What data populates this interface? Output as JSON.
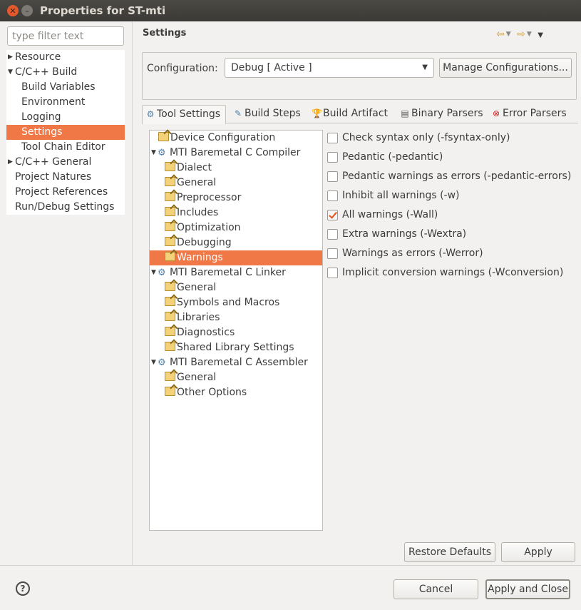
{
  "window": {
    "title": "Properties for ST-mti"
  },
  "filter": {
    "placeholder": "type filter text"
  },
  "nav": {
    "items": [
      {
        "label": "Resource",
        "level": 0,
        "arrow": "right"
      },
      {
        "label": "C/C++ Build",
        "level": 0,
        "arrow": "down"
      },
      {
        "label": "Build Variables",
        "level": 1
      },
      {
        "label": "Environment",
        "level": 1
      },
      {
        "label": "Logging",
        "level": 1
      },
      {
        "label": "Settings",
        "level": 1,
        "selected": true
      },
      {
        "label": "Tool Chain Editor",
        "level": 1
      },
      {
        "label": "C/C++ General",
        "level": 0,
        "arrow": "right"
      },
      {
        "label": "Project Natures",
        "level": 0
      },
      {
        "label": "Project References",
        "level": 0
      },
      {
        "label": "Run/Debug Settings",
        "level": 0
      }
    ]
  },
  "page": {
    "title": "Settings"
  },
  "config": {
    "label": "Configuration:",
    "value": "Debug  [ Active ]",
    "manage_label": "Manage Configurations..."
  },
  "tabs": [
    {
      "label": "Tool Settings",
      "icon": "tool-settings-icon",
      "active": true
    },
    {
      "label": "Build Steps",
      "icon": "build-steps-icon"
    },
    {
      "label": "Build Artifact",
      "icon": "trophy-icon"
    },
    {
      "label": "Binary Parsers",
      "icon": "binary-icon"
    },
    {
      "label": "Error Parsers",
      "icon": "error-icon"
    }
  ],
  "tool_tree": [
    {
      "label": "Device Configuration",
      "type": "folder",
      "level": 1
    },
    {
      "label": "MTI Baremetal C Compiler",
      "type": "tool",
      "level": 0
    },
    {
      "label": "Dialect",
      "type": "folder",
      "level": 2
    },
    {
      "label": "General",
      "type": "folder",
      "level": 2
    },
    {
      "label": "Preprocessor",
      "type": "folder",
      "level": 2
    },
    {
      "label": "Includes",
      "type": "folder",
      "level": 2
    },
    {
      "label": "Optimization",
      "type": "folder",
      "level": 2
    },
    {
      "label": "Debugging",
      "type": "folder",
      "level": 2
    },
    {
      "label": "Warnings",
      "type": "folder",
      "level": 2,
      "selected": true
    },
    {
      "label": "MTI Baremetal C Linker",
      "type": "tool",
      "level": 0
    },
    {
      "label": "General",
      "type": "folder",
      "level": 2
    },
    {
      "label": "Symbols and Macros",
      "type": "folder",
      "level": 2
    },
    {
      "label": "Libraries",
      "type": "folder",
      "level": 2
    },
    {
      "label": "Diagnostics",
      "type": "folder",
      "level": 2
    },
    {
      "label": "Shared Library Settings",
      "type": "folder",
      "level": 2
    },
    {
      "label": "MTI Baremetal C Assembler",
      "type": "tool",
      "level": 0
    },
    {
      "label": "General",
      "type": "folder",
      "level": 2
    },
    {
      "label": "Other Options",
      "type": "folder",
      "level": 2
    }
  ],
  "options": [
    {
      "label": "Check syntax only (-fsyntax-only)",
      "checked": false
    },
    {
      "label": "Pedantic (-pedantic)",
      "checked": false
    },
    {
      "label": "Pedantic warnings as errors (-pedantic-errors)",
      "checked": false
    },
    {
      "label": "Inhibit all warnings (-w)",
      "checked": false
    },
    {
      "label": "All warnings (-Wall)",
      "checked": true
    },
    {
      "label": "Extra warnings (-Wextra)",
      "checked": false
    },
    {
      "label": "Warnings as errors (-Werror)",
      "checked": false
    },
    {
      "label": "Implicit conversion warnings (-Wconversion)",
      "checked": false
    }
  ],
  "buttons": {
    "restore_defaults": "Restore Defaults",
    "apply": "Apply",
    "cancel": "Cancel",
    "apply_and_close": "Apply and Close",
    "help": "?"
  },
  "colors": {
    "selection": "#f07746",
    "check": "#e0531f"
  }
}
